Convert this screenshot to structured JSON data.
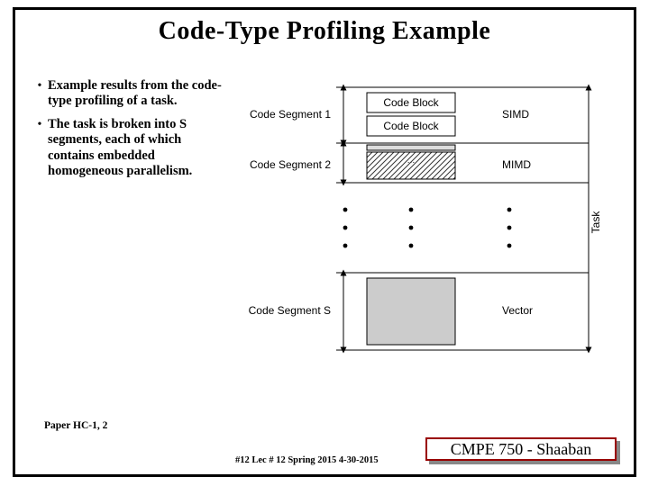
{
  "title": "Code-Type Profiling Example",
  "bullets": [
    "Example results from the code-type profiling of a task.",
    "The task is broken into S segments, each of which contains embedded homogeneous parallelism."
  ],
  "diagram": {
    "seg1": "Code Segment 1",
    "seg2": "Code Segment 2",
    "segS": "Code Segment S",
    "blk1": "Code Block",
    "blk2": "Code Block",
    "type1": "SIMD",
    "type2": "MIMD",
    "type3": "Vector",
    "task": "Task"
  },
  "paper_ref": "Paper HC-1, 2",
  "footer_page": "#12  Lec # 12   Spring 2015  4-30-2015",
  "footer_course": "CMPE 750 - Shaaban"
}
